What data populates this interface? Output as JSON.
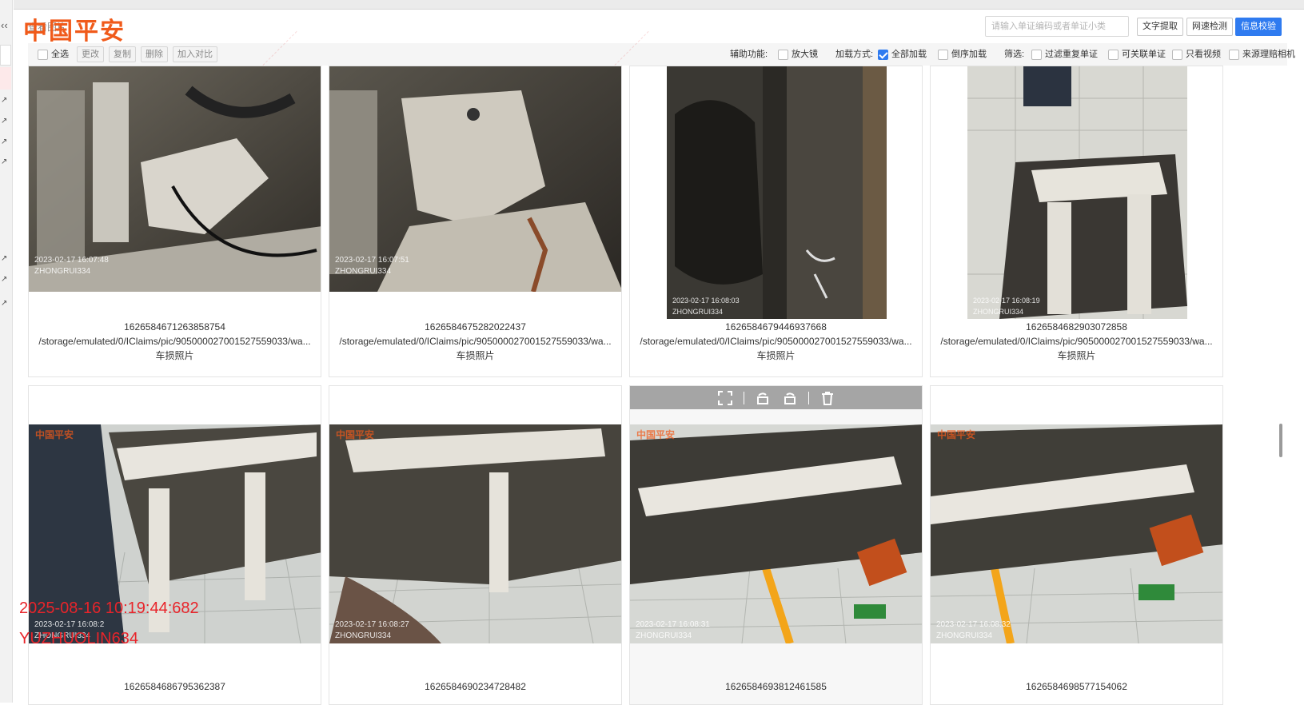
{
  "brand": {
    "logo_text": "中国平安",
    "accent_color": "#f05a1a"
  },
  "header": {
    "title": "查看图片",
    "search_placeholder": "请输入单证编码或者单证小类",
    "buttons": [
      "文字提取",
      "网速检测",
      "信息校验"
    ]
  },
  "toolbar": {
    "select_all": "全选",
    "actions": [
      "更改",
      "复制",
      "删除",
      "加入对比"
    ],
    "assist_label": "辅助功能:",
    "magnifier": "放大镜",
    "load_mode_label": "加载方式:",
    "load_all": "全部加载",
    "load_reverse": "倒序加载",
    "filter_label": "筛选:",
    "filter_dupes": "过滤重复单证",
    "linkable": "可关联单证",
    "video_only": "只看视频",
    "source_camera": "来源理赔相机"
  },
  "photos": [
    {
      "id": "1626584671263858754",
      "path": "/storage/emulated/0/IClaims/pic/905000027001527559033/wa...",
      "type": "车损照片",
      "stamp_time": "2023-02-17 16:07:48",
      "stamp_user": "ZHONGRUI334"
    },
    {
      "id": "1626584675282022437",
      "path": "/storage/emulated/0/IClaims/pic/905000027001527559033/wa...",
      "type": "车损照片",
      "stamp_time": "2023-02-17 16:07:51",
      "stamp_user": "ZHONGRUI334"
    },
    {
      "id": "1626584679446937668",
      "path": "/storage/emulated/0/IClaims/pic/905000027001527559033/wa...",
      "type": "车损照片",
      "stamp_time": "2023-02-17 16:08:03",
      "stamp_user": "ZHONGRUI334"
    },
    {
      "id": "1626584682903072858",
      "path": "/storage/emulated/0/IClaims/pic/905000027001527559033/wa...",
      "type": "车损照片",
      "stamp_time": "2023-02-17 16:08:19",
      "stamp_user": "ZHONGRUI334"
    },
    {
      "id": "1626584686795362387",
      "stamp_time": "2023-02-17 16:08:2",
      "stamp_user": "ZHONGRUI334"
    },
    {
      "id": "1626584690234728482",
      "stamp_time": "2023-02-17 16:08:27",
      "stamp_user": "ZHONGRUI334"
    },
    {
      "id": "1626584693812461585",
      "stamp_time": "2023-02-17 16:08:31",
      "stamp_user": "ZHONGRUI334"
    },
    {
      "id": "1626584698577154062",
      "stamp_time": "2023-02-17 16:08:32",
      "stamp_user": "ZHONGRUI334"
    }
  ],
  "overlay": {
    "timestamp": "2025-08-16 10:19:44:682",
    "user": "YUZHUOLIN634",
    "color": "#e8242a"
  }
}
